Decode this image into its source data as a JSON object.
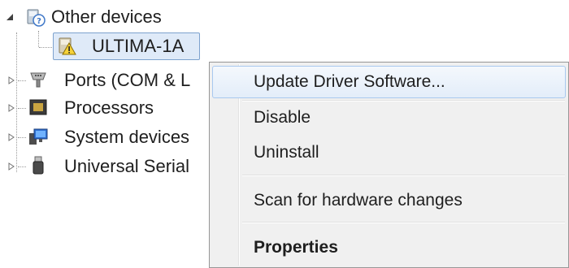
{
  "tree": {
    "items": [
      {
        "label": "Other devices",
        "icon": "unknown-device-icon",
        "expanded": true
      },
      {
        "label": "ULTIMA-1A",
        "icon": "warning-device-icon",
        "selected": true
      },
      {
        "label": "Ports (COM & L",
        "icon": "port-icon",
        "expanded": false
      },
      {
        "label": "Processors",
        "icon": "processor-icon",
        "expanded": false
      },
      {
        "label": "System devices",
        "icon": "system-devices-icon",
        "expanded": false
      },
      {
        "label": "Universal Serial",
        "icon": "usb-icon",
        "expanded": false
      }
    ]
  },
  "context_menu": {
    "items": [
      {
        "label": "Update Driver Software...",
        "highlighted": true
      },
      {
        "label": "Disable"
      },
      {
        "label": "Uninstall"
      },
      {
        "label": "Scan for hardware changes"
      },
      {
        "label": "Properties",
        "bold": true
      }
    ]
  },
  "colors": {
    "selection": "#dfeaf8",
    "selection_border": "#7da2ce",
    "menu_background": "#f0f0f0",
    "menu_highlight_border": "#a8c8ef"
  }
}
